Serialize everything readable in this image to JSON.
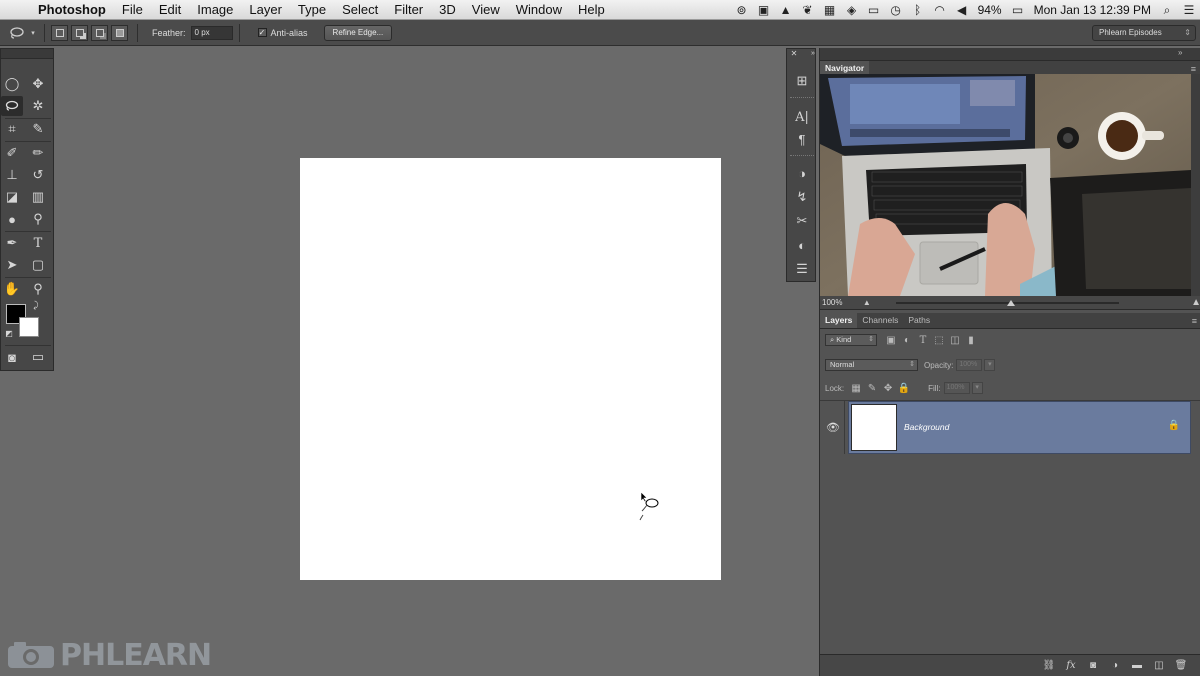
{
  "menubar": {
    "app": "Photoshop",
    "menus": [
      "File",
      "Edit",
      "Image",
      "Layer",
      "Type",
      "Select",
      "Filter",
      "3D",
      "View",
      "Window",
      "Help"
    ],
    "battery": "94%",
    "datetime": "Mon Jan 13  12:39 PM"
  },
  "options_bar": {
    "active_tool_icon": "lasso-icon",
    "feather_label": "Feather:",
    "feather_value": "0 px",
    "anti_alias_label": "Anti-alias",
    "anti_alias_checked": true,
    "refine_edge_label": "Refine Edge..."
  },
  "workspace": {
    "name": "Phlearn Episodes"
  },
  "toolbox": {
    "tools": [
      "marquee-tool",
      "move-tool",
      "lasso-tool",
      "magic-wand-tool",
      "crop-tool",
      "eyedropper-tool",
      "healing-brush-tool",
      "brush-tool",
      "clone-stamp-tool",
      "history-brush-tool",
      "eraser-tool",
      "gradient-tool",
      "blur-tool",
      "dodge-tool",
      "pen-tool",
      "type-tool",
      "path-selection-tool",
      "shape-tool",
      "hand-tool",
      "zoom-tool"
    ],
    "foreground_color": "#000000",
    "background_color": "#ffffff"
  },
  "navigator": {
    "title": "Navigator",
    "zoom": "100%",
    "zoom_fraction": 0.5
  },
  "layers_panel": {
    "tabs": [
      "Layers",
      "Channels",
      "Paths"
    ],
    "filter_kind": "Kind",
    "blend_mode": "Normal",
    "opacity_label": "Opacity:",
    "opacity_value": "100%",
    "lock_label": "Lock:",
    "fill_label": "Fill:",
    "fill_value": "100%",
    "layers": [
      {
        "name": "Background",
        "visible": true,
        "locked": true,
        "selected": true
      }
    ]
  },
  "watermark": {
    "text": "PHLEARN"
  },
  "colors": {
    "workspace_bg": "#6a6a6a",
    "panel_bg": "#535353",
    "selected_layer": "#6a7b9e"
  }
}
